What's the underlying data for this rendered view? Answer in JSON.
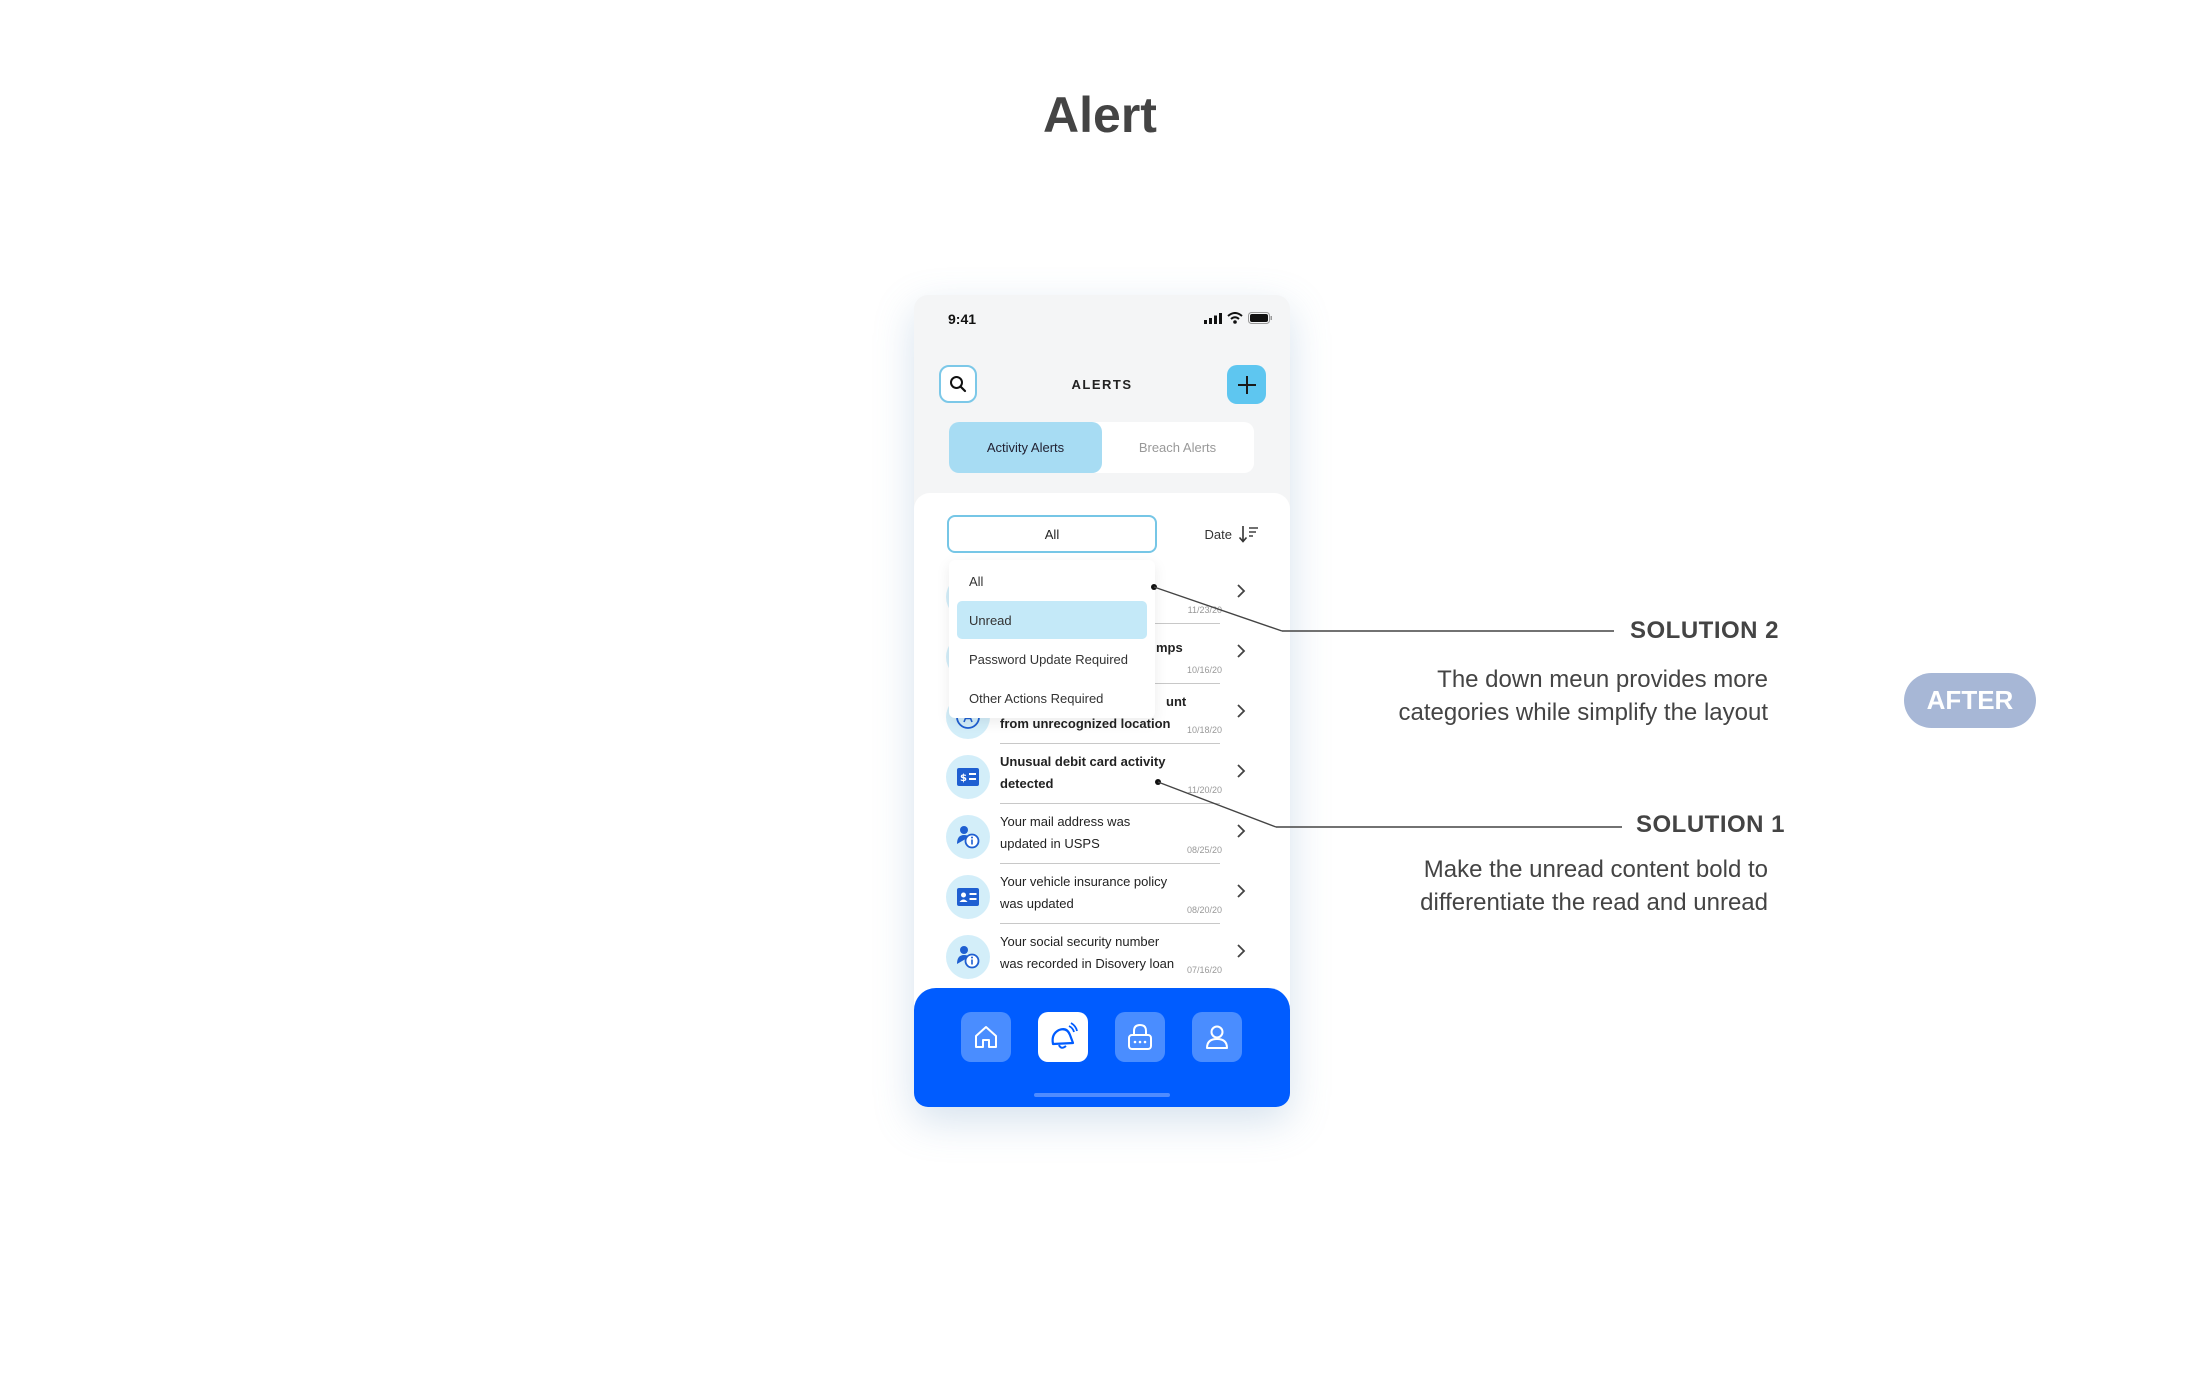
{
  "page": {
    "title": "Alert",
    "badge": "AFTER"
  },
  "phone": {
    "status": {
      "time": "9:41"
    },
    "header": {
      "title": "ALERTS"
    },
    "tabs": [
      {
        "label": "Activity Alerts",
        "active": true
      },
      {
        "label": "Breach Alerts",
        "active": false
      }
    ],
    "filter": {
      "selected": "All"
    },
    "sort": {
      "label": "Date"
    },
    "dropdown": {
      "options": [
        "All",
        "Unread",
        "Password Update Required",
        "Other Actions Required"
      ],
      "highlighted": "Unread"
    },
    "alerts": [
      {
        "line1": "",
        "line2": "",
        "date": "11/23/20",
        "bold": true,
        "icon": "info-icon"
      },
      {
        "line1": "mps",
        "line2": "",
        "date": "10/16/20",
        "bold": true,
        "icon": "info-icon"
      },
      {
        "line1": "unt",
        "line2": "from unrecognized location",
        "date": "10/18/20",
        "bold": true,
        "icon": "app-store-icon"
      },
      {
        "line1": "Unusual debit card activity",
        "line2": "detected",
        "date": "11/20/20",
        "bold": true,
        "icon": "debit-card-icon"
      },
      {
        "line1": "Your  mail address was",
        "line2": "updated in USPS",
        "date": "08/25/20",
        "bold": false,
        "icon": "person-info-icon"
      },
      {
        "line1": "Your vehicle insurance policy",
        "line2": "was updated",
        "date": "08/20/20",
        "bold": false,
        "icon": "id-card-icon"
      },
      {
        "line1": "Your social security number",
        "line2": "was recorded in Disovery loan",
        "date": "07/16/20",
        "bold": false,
        "icon": "person-info-icon"
      }
    ],
    "nav": [
      {
        "icon": "home-icon",
        "active": false
      },
      {
        "icon": "alert-icon",
        "active": true
      },
      {
        "icon": "lock-icon",
        "active": false
      },
      {
        "icon": "profile-icon",
        "active": false
      }
    ]
  },
  "callouts": [
    {
      "title": "SOLUTION 2",
      "desc_line1": "The down meun provides more",
      "desc_line2": "categories while simplify the layout"
    },
    {
      "title": "SOLUTION 1",
      "desc_line1": "Make the unread content bold to",
      "desc_line2": "differentiate the read and unread"
    }
  ],
  "colors": {
    "accent_blue": "#005cff",
    "light_blue": "#a7dcf3",
    "border_blue": "#76c6e6",
    "icon_blue": "#1f5fd1",
    "badge": "#a7b7d6"
  }
}
